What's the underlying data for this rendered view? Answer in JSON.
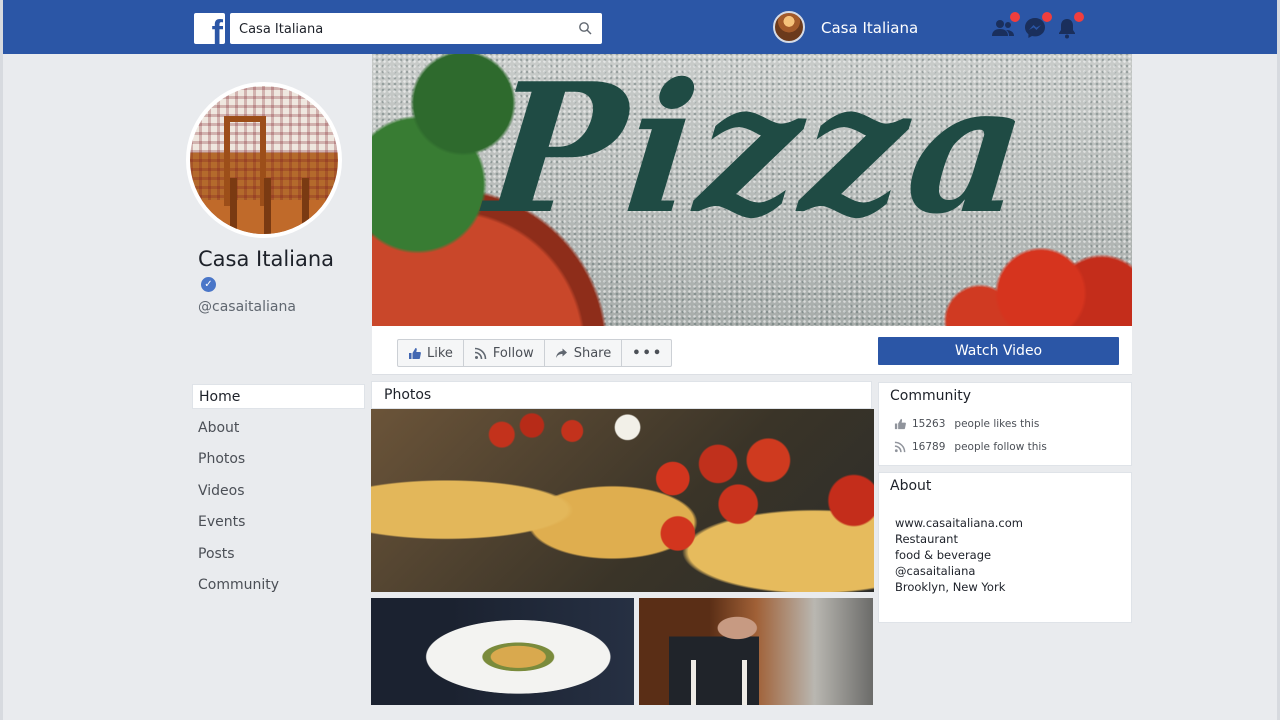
{
  "colors": {
    "brand": "#2b56a6",
    "background": "#e9ebee",
    "verified": "#4a76c8",
    "notification": "#f03e3e"
  },
  "topbar": {
    "logo_glyph": "f",
    "search": {
      "value": "Casa Italiana"
    },
    "profile_name": "Casa Italiana",
    "icons": [
      "friends-icon",
      "messenger-icon",
      "bell-icon"
    ]
  },
  "page": {
    "name": "Casa Italiana",
    "verified_glyph": "✓",
    "handle": "@casaitaliana",
    "cover_word": "Pizza"
  },
  "nav": {
    "items": [
      {
        "label": "Home",
        "active": true
      },
      {
        "label": "About"
      },
      {
        "label": "Photos"
      },
      {
        "label": "Videos"
      },
      {
        "label": "Events"
      },
      {
        "label": "Posts"
      },
      {
        "label": "Community"
      }
    ]
  },
  "actions": {
    "like": "Like",
    "follow": "Follow",
    "share": "Share",
    "more": "•••",
    "watch_video": "Watch Video"
  },
  "photos": {
    "title": "Photos"
  },
  "community": {
    "title": "Community",
    "likes_count": "15263",
    "likes_text": "people likes this",
    "follow_count": "16789",
    "follow_text": "people follow this"
  },
  "about": {
    "title": "About",
    "website": "www.casaitaliana.com",
    "category": "Restaurant",
    "subcategory": "food & beverage",
    "handle": "@casaitaliana",
    "location": "Brooklyn, New York"
  }
}
